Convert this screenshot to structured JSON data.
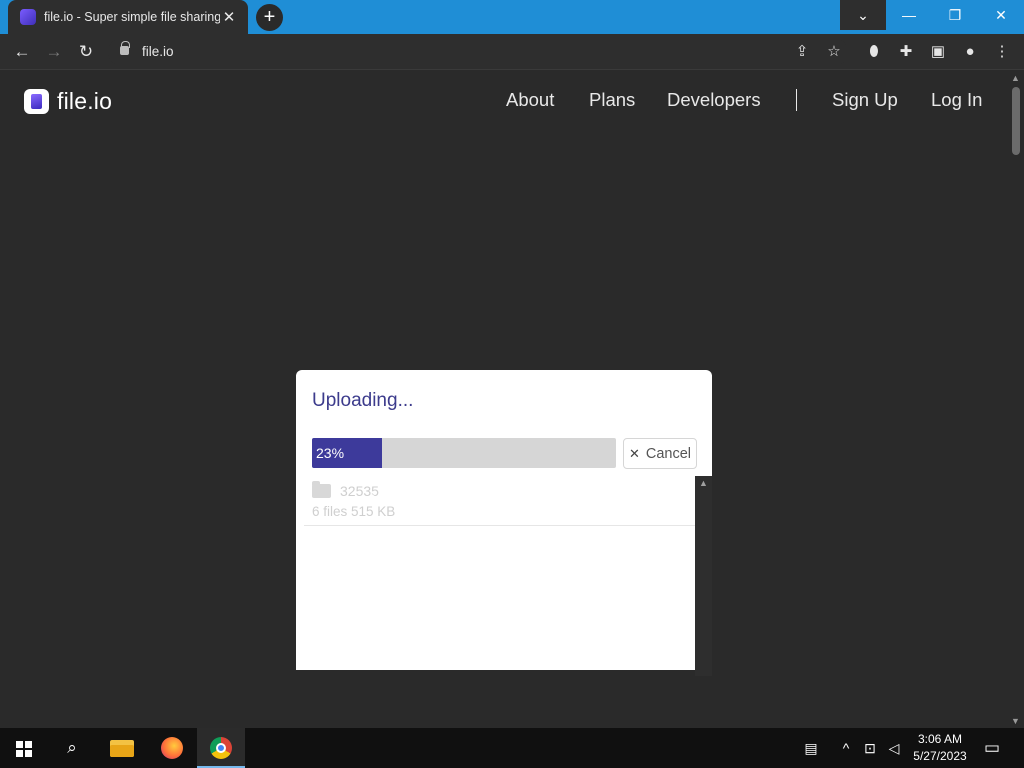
{
  "browser": {
    "tab_title": "file.io - Super simple file sharing",
    "tab_close": "✕",
    "new_tab": "+",
    "url": "file.io",
    "icons": {
      "back": "←",
      "forward": "→",
      "reload": "↻",
      "share": "⇪",
      "star": "☆",
      "extension_shield": "⬮",
      "puzzle": "✚",
      "side_panel": "▣",
      "profile": "●",
      "menu": "⋮"
    },
    "window_controls": {
      "tab_search": "⌄",
      "minimize": "—",
      "restore": "❐",
      "close": "✕"
    }
  },
  "site": {
    "logo_text": "file.io",
    "nav": [
      "About",
      "Plans",
      "Developers",
      "Sign Up",
      "Log In"
    ]
  },
  "upload": {
    "title": "Uploading...",
    "progress_percent": 23,
    "progress_label": "23%",
    "cancel_icon": "✕",
    "cancel_label": "Cancel",
    "files": [
      {
        "name": "32535",
        "meta": "6 files 515 KB"
      }
    ]
  },
  "taskbar": {
    "search_icon": "⌕",
    "tray": {
      "news": "▤",
      "chevron": "^",
      "network": "⊡",
      "volume": "◁"
    },
    "time": "3:06 AM",
    "date": "5/27/2023",
    "notifications": "▭"
  },
  "colors": {
    "accent": "#3d3a9b",
    "title": "#3c3b8c",
    "tabbar": "#1f8ed6"
  }
}
